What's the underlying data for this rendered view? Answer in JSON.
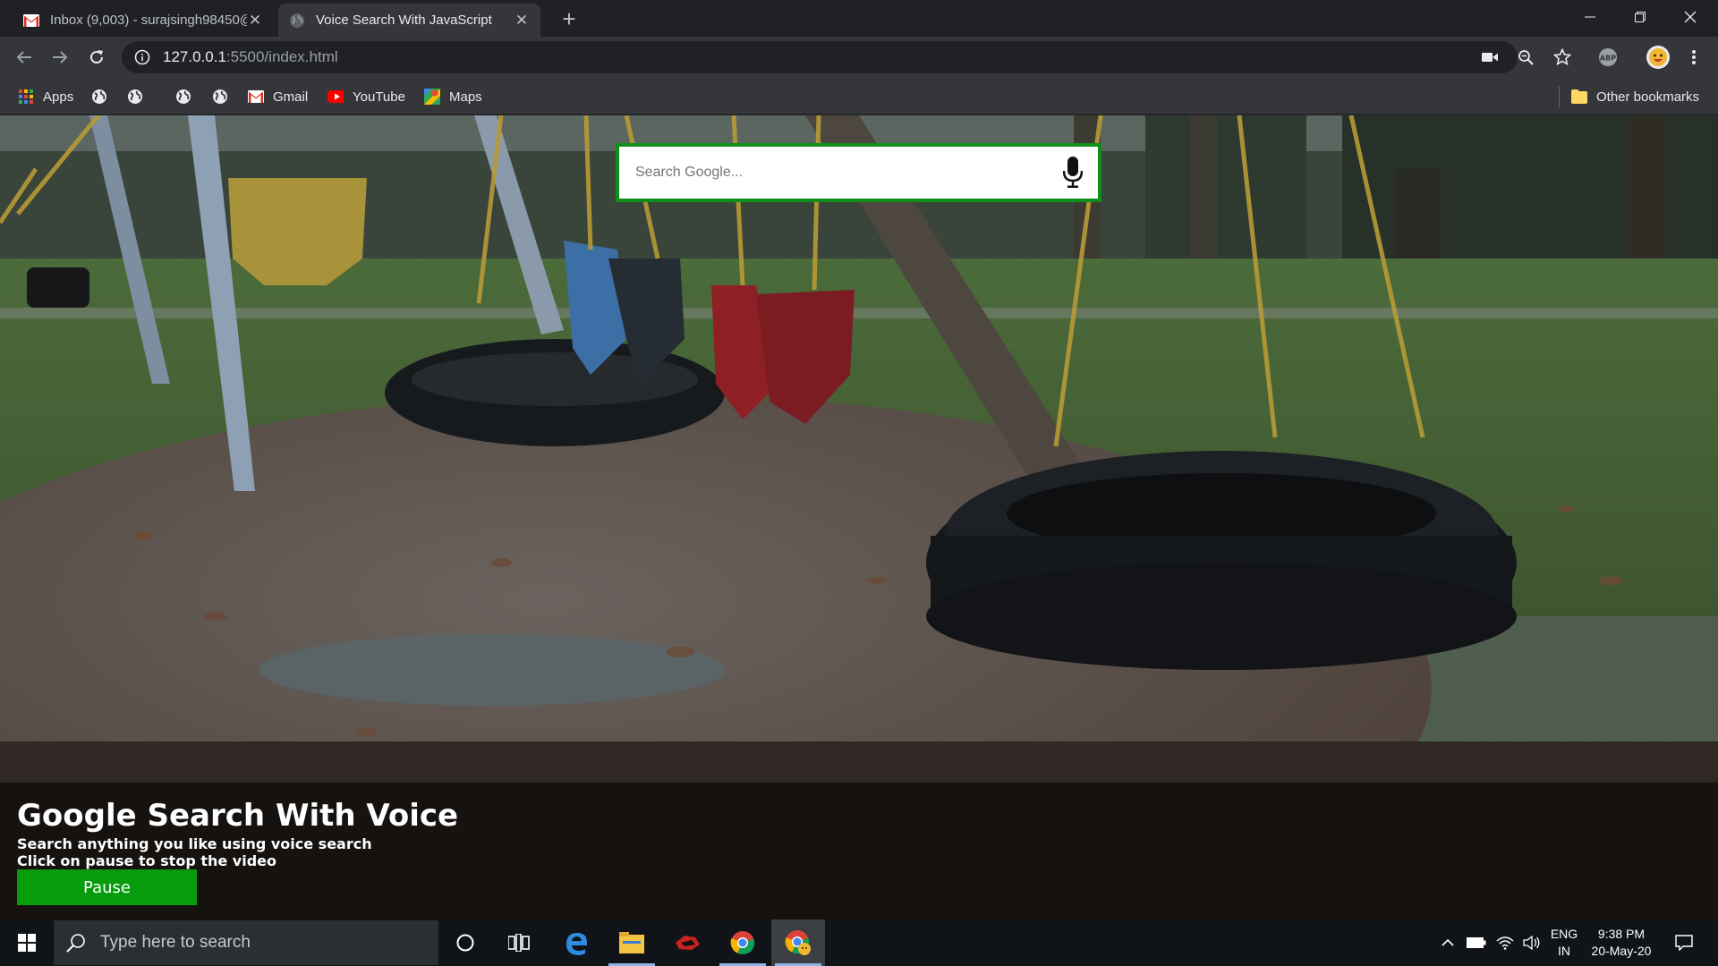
{
  "browser": {
    "tabs": [
      {
        "title": "Inbox (9,003) - surajsingh98450@",
        "icon": "gmail-icon",
        "active": false
      },
      {
        "title": "Voice Search With JavaScript",
        "icon": "globe-icon",
        "active": true
      }
    ],
    "url": {
      "host": "127.0.0.1",
      "path": ":5500/index.html"
    },
    "bookmarks": [
      {
        "label": "Apps",
        "icon": "apps-grid-icon"
      },
      {
        "label": "",
        "icon": "globe-icon"
      },
      {
        "label": "",
        "icon": "globe-icon"
      },
      {
        "label": "",
        "icon": "globe-icon"
      },
      {
        "label": "",
        "icon": "globe-icon"
      },
      {
        "label": "Gmail",
        "icon": "gmail-icon"
      },
      {
        "label": "YouTube",
        "icon": "youtube-icon"
      },
      {
        "label": "Maps",
        "icon": "maps-icon"
      }
    ],
    "other_bookmarks": "Other bookmarks",
    "extension_badge": "ABP"
  },
  "page": {
    "search_placeholder": "Search Google...",
    "title": "Google Search With Voice",
    "subtitle_1": "Search anything you like using voice search",
    "subtitle_2": "Click on pause to stop the video",
    "pause_label": "Pause",
    "accent_color": "#0f8f1a",
    "button_color": "#069c0b"
  },
  "taskbar": {
    "search_placeholder": "Type here to search",
    "lang_1": "ENG",
    "lang_2": "IN",
    "time": "9:38 PM",
    "date": "20-May-20"
  }
}
